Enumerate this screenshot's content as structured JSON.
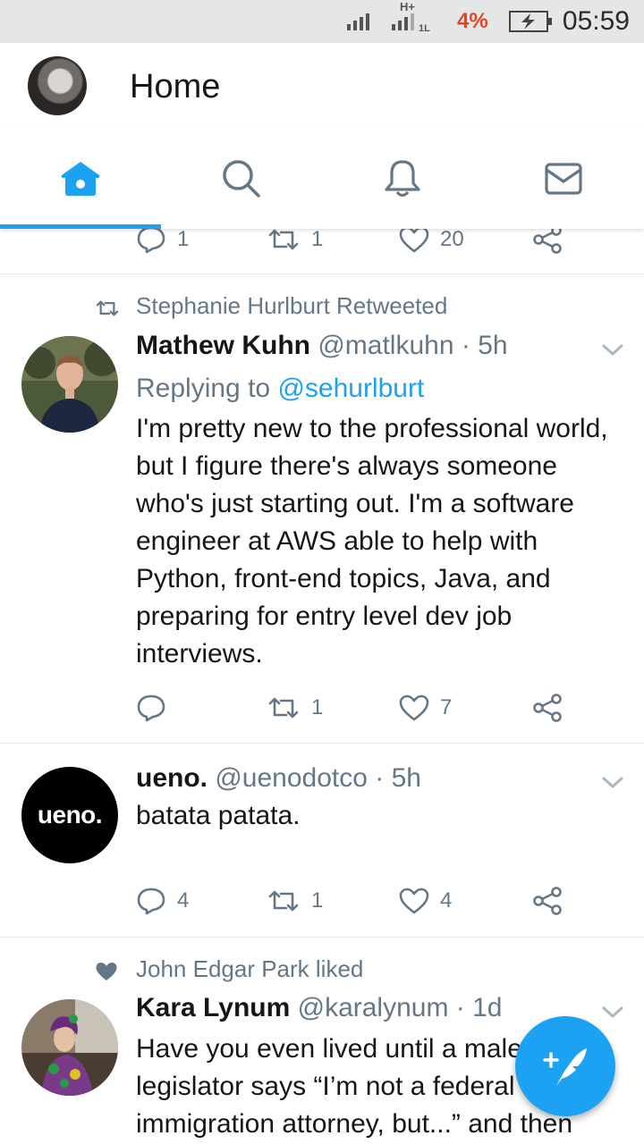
{
  "status_bar": {
    "network": "H+",
    "network_small": "1L",
    "battery_pct": "4%",
    "time": "05:59"
  },
  "header": {
    "title": "Home"
  },
  "tabs": [
    {
      "name": "home",
      "icon": "home-icon",
      "active": true
    },
    {
      "name": "search",
      "icon": "search-icon",
      "active": false
    },
    {
      "name": "notifications",
      "icon": "bell-icon",
      "active": false
    },
    {
      "name": "messages",
      "icon": "envelope-icon",
      "active": false
    }
  ],
  "colors": {
    "accent": "#1da1f2",
    "muted": "#657786",
    "text": "#14171a",
    "battery_low": "#e8431b"
  },
  "partial_tweet": {
    "replies": "1",
    "retweets": "1",
    "likes": "20"
  },
  "tweets": [
    {
      "social_context": "Stephanie Hurlburt Retweeted",
      "name": "Mathew  Kuhn",
      "handle": "@matlkuhn",
      "time": "· 5h",
      "replying_prefix": "Replying to",
      "replying_to": "@sehurlburt",
      "text": "I'm pretty new to the professional world, but I figure there's always someone who's just starting out. I'm a software engineer at AWS able to help with Python, front-end topics, Java, and preparing for entry level dev job interviews.",
      "replies": "",
      "retweets": "1",
      "likes": "7"
    },
    {
      "name": "ueno.",
      "handle": "@uenodotco",
      "time": "· 5h",
      "avatar_text": "ueno.",
      "text": "batata patata.",
      "replies": "4",
      "retweets": "1",
      "likes": "4"
    },
    {
      "social_context": "John Edgar Park liked",
      "name": "Kara Lynum",
      "handle": "@karalynum",
      "time": "· 1d",
      "text": "Have you even lived until a male legislator says “I’m not a federal immigration attorney, but...” and then"
    }
  ]
}
